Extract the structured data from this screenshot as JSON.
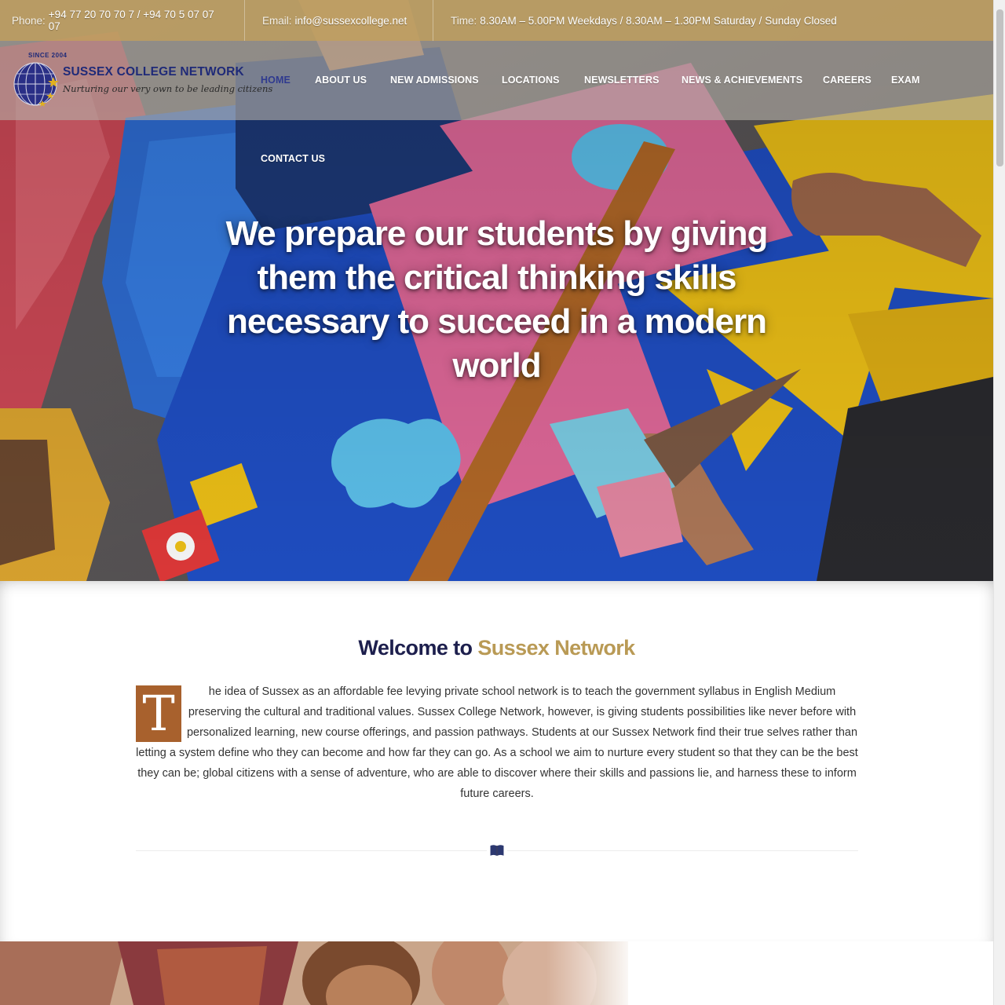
{
  "topbar": {
    "phone_label": "Phone:",
    "phone_value": "+94 77 20 70 70 7 / +94 70 5 07 07 07",
    "email_label": "Email:",
    "email_value": "info@sussexcollege.net",
    "time_label": "Time:",
    "time_value": "8.30AM – 5.00PM Weekdays / 8.30AM – 1.30PM Saturday / Sunday Closed"
  },
  "logo": {
    "since": "SINCE 2004",
    "name": "SUSSEX COLLEGE NETWORK",
    "tagline": "Nurturing our very own to be leading citizens"
  },
  "nav": {
    "items": [
      {
        "label": "HOME",
        "active": true
      },
      {
        "label": "ABOUT US"
      },
      {
        "label": "NEW ADMISSIONS"
      },
      {
        "label": "LOCATIONS"
      },
      {
        "label": "NEWSLETTERS"
      },
      {
        "label": "NEWS & ACHIEVEMENTS"
      },
      {
        "label": "CAREERS"
      },
      {
        "label": "EXAM"
      },
      {
        "label": "CONTACT US"
      }
    ]
  },
  "hero": {
    "title": "We prepare our students by giving them the critical thinking skills necessary to succeed in a modern world"
  },
  "welcome": {
    "title_part1": "Welcome to",
    "title_part2": "Sussex Network",
    "dropcap": "T",
    "body": "he idea of Sussex as an affordable fee levying private school network is to teach the government syllabus in English Medium preserving the cultural and traditional values. Sussex College Network, however, is giving students possibilities like never before with personalized learning, new course offerings, and passion pathways. Students at our Sussex Network find their true selves rather than letting a system define who they can become and how far they can go. As a school we aim to nurture every student so that they can be the best they can be; global citizens with a sense of adventure, who are able to discover where their skills and passions lie, and harness these to inform future careers.",
    "divider_icon": "book-icon"
  },
  "colors": {
    "topbar": "#c0a266",
    "brand_navy": "#1d1f4d",
    "brand_gold": "#b99a55",
    "nav_active": "#2f3a8f",
    "dropcap_bg": "#a8612d"
  }
}
